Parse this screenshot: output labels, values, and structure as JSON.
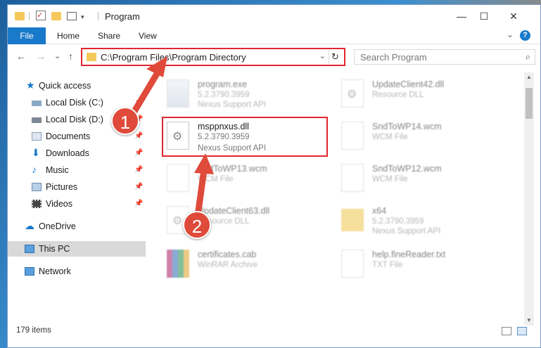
{
  "window": {
    "title": "Program",
    "quick_access_check": "✓",
    "dropdown_glyph": "▾",
    "controls": {
      "minimize": "—",
      "maximize": "☐",
      "close": "✕"
    }
  },
  "ribbon": {
    "tabs": [
      "File",
      "Home",
      "Share",
      "View"
    ],
    "collapse_glyph": "⌄",
    "help_glyph": "?"
  },
  "nav": {
    "back": "←",
    "forward": "→",
    "recent": "⌄",
    "up": "↑",
    "address": "C:\\Program Files\\Program Directory",
    "address_dropdown": "⌄",
    "refresh": "↻",
    "search_placeholder": "Search Program",
    "search_icon": "⌕"
  },
  "navpane": {
    "quick_access": "Quick access",
    "items": [
      {
        "label": "Local Disk (C:)",
        "icon": "drive-icon",
        "pinned": true
      },
      {
        "label": "Local Disk (D:)",
        "icon": "drive-icon",
        "pinned": true
      },
      {
        "label": "Documents",
        "icon": "documents-icon",
        "pinned": true
      },
      {
        "label": "Downloads",
        "icon": "downloads-icon",
        "pinned": true
      },
      {
        "label": "Music",
        "icon": "music-icon",
        "pinned": true
      },
      {
        "label": "Pictures",
        "icon": "pictures-icon",
        "pinned": true
      },
      {
        "label": "Videos",
        "icon": "videos-icon",
        "pinned": true
      }
    ],
    "pin_glyph": "📌",
    "onedrive": "OneDrive",
    "this_pc": "This PC",
    "network": "Network"
  },
  "files": [
    {
      "name": "program.exe",
      "line2": "5.2.3790.3959",
      "line3": "Nexus Support API",
      "icon": "exe"
    },
    {
      "name": "UpdateClient42.dll",
      "line2": "Resource DLL",
      "line3": "",
      "icon": "gear"
    },
    {
      "name": "SndToWP14.wcm",
      "line2": "WCM File",
      "line3": "",
      "icon": "doc"
    },
    {
      "name": "SndToWP13.wcm",
      "line2": "WCM File",
      "line3": "",
      "icon": "doc"
    },
    {
      "name": "SndToWP12.wcm",
      "line2": "WCM File",
      "line3": "",
      "icon": "doc"
    },
    {
      "name": "UpdateClient63.dll",
      "line2": "Resource DLL",
      "line3": "",
      "icon": "gear"
    },
    {
      "name": "x64",
      "line2": "5.2.3790.3959",
      "line3": "Nexus Support API",
      "icon": "folder"
    },
    {
      "name": "certificates.cab",
      "line2": "WinRAR Archive",
      "line3": "",
      "icon": "rar"
    },
    {
      "name": "help.fineReader.txt",
      "line2": "TXT File",
      "line3": "",
      "icon": "doc"
    }
  ],
  "highlighted_file": {
    "name": "msppnxus.dll",
    "line2": "5.2.3790.3959",
    "line3": "Nexus Support API"
  },
  "status": {
    "items": "179 items"
  },
  "annotations": {
    "step1": "1",
    "step2": "2",
    "color": "#df4a3a"
  }
}
